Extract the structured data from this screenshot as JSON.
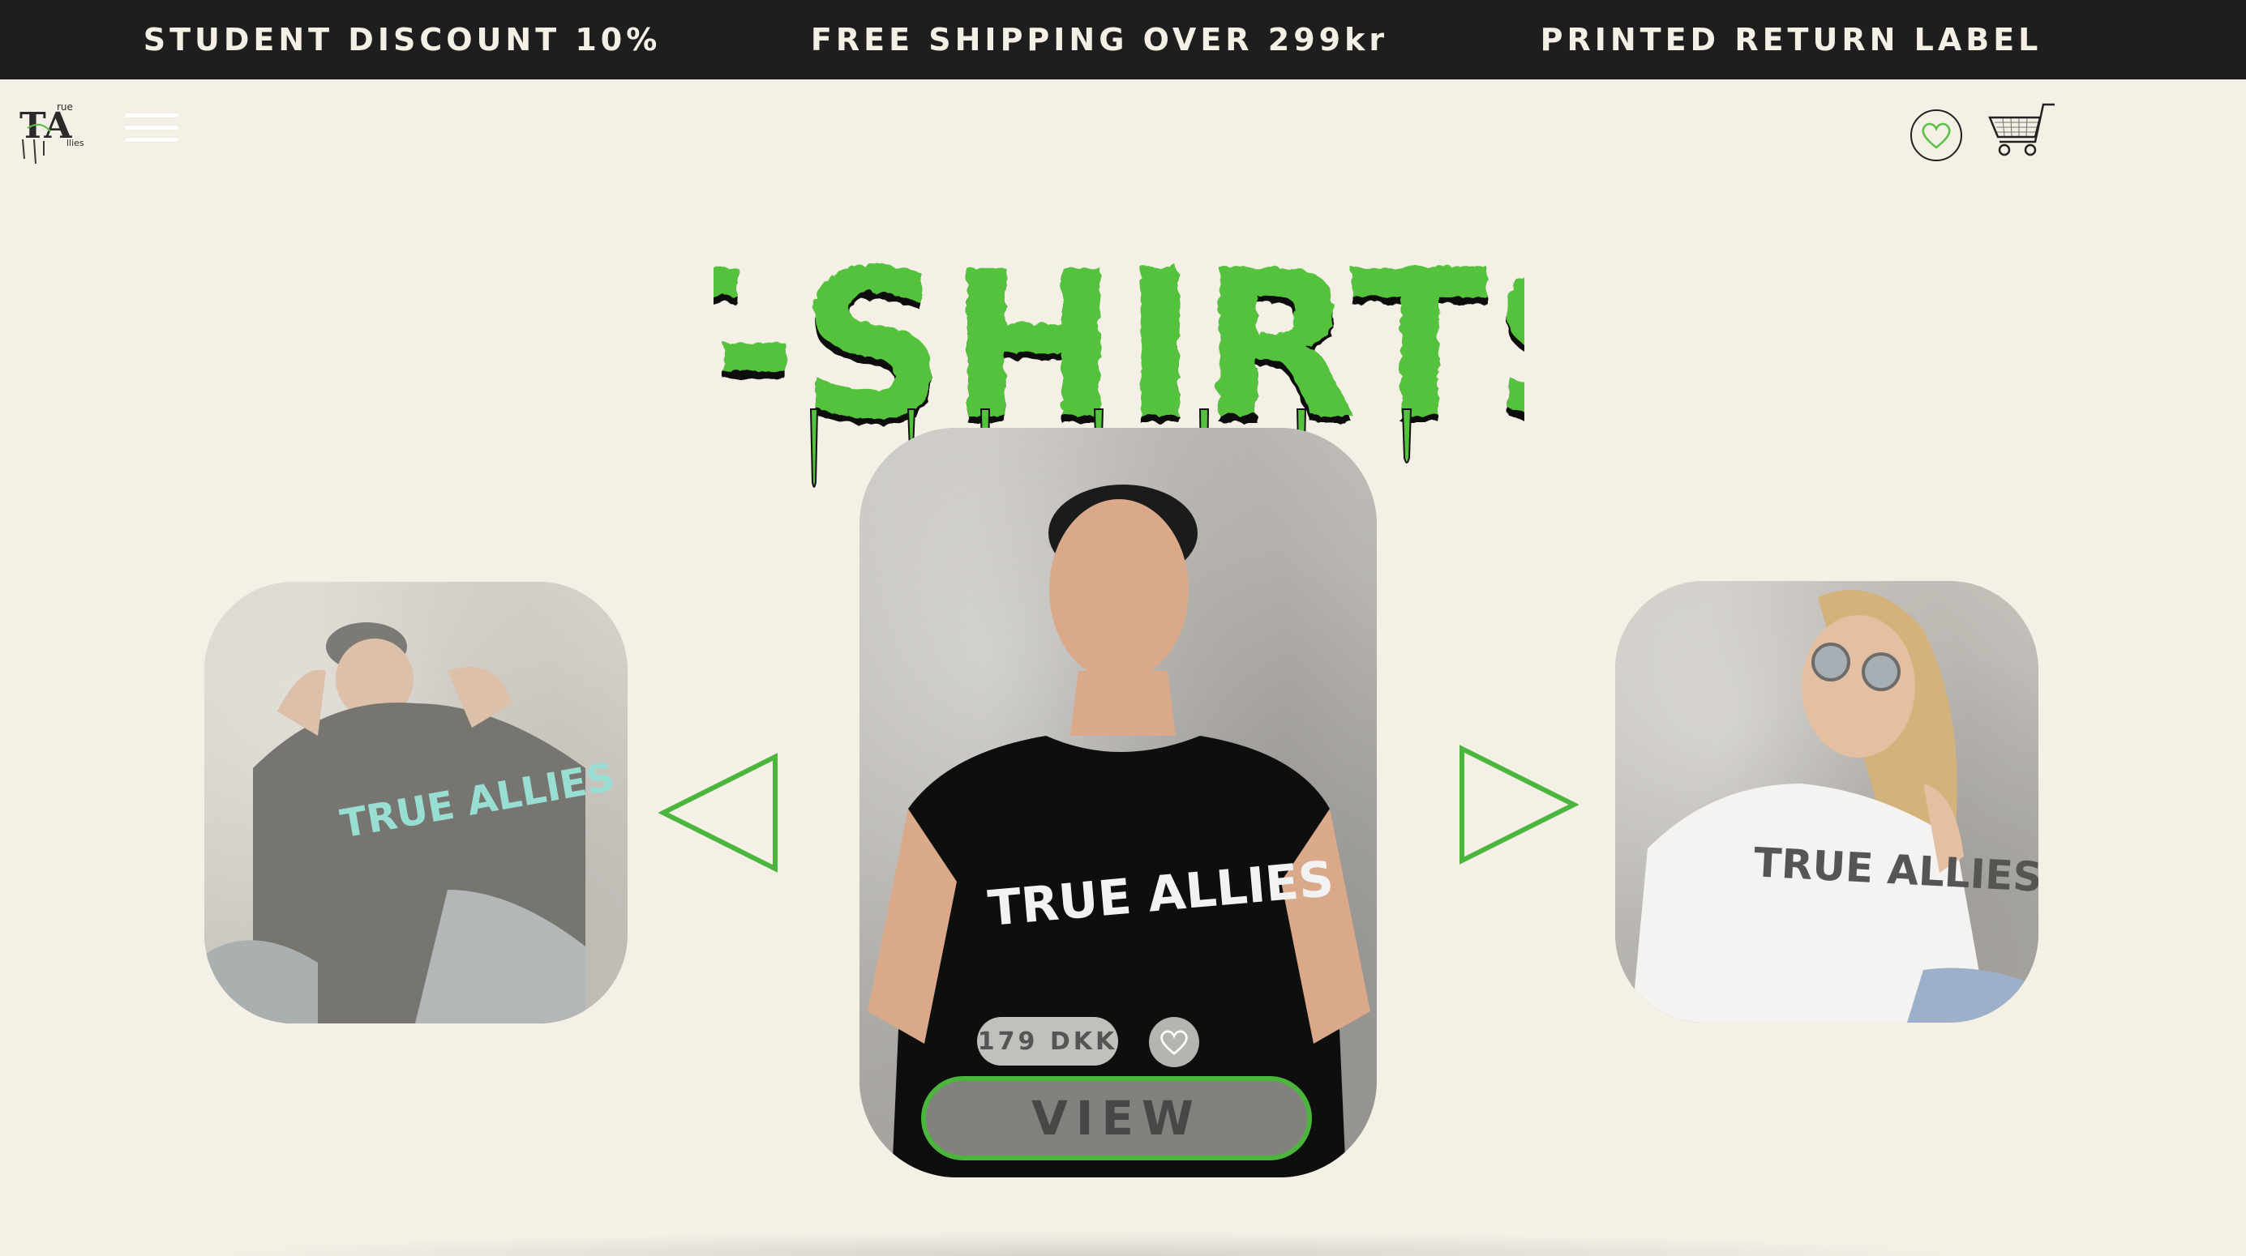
{
  "promo_bar": {
    "items": [
      "STUDENT DISCOUNT 10%",
      "FREE SHIPPING OVER 299kr",
      "PRINTED RETURN LABEL"
    ]
  },
  "header": {
    "logo_text": "TA",
    "logo_subtext_1": "rue",
    "logo_subtext_2": "llies",
    "icons": [
      "hamburger-menu-icon",
      "heart-icon",
      "shopping-cart-icon"
    ]
  },
  "hero": {
    "title": "T-SHIRTS"
  },
  "carousel": {
    "shirt_print": "TRUE ALLIES",
    "featured": {
      "price": "179 DKK",
      "cta_label": "VIEW"
    },
    "nav_icons": [
      "previous-arrow-icon",
      "next-arrow-icon"
    ]
  },
  "colors": {
    "background": "#f4f0e6",
    "promo_bar": "#1e1e1e",
    "accent_green": "#4bb53d",
    "title_green": "#55c23d"
  }
}
